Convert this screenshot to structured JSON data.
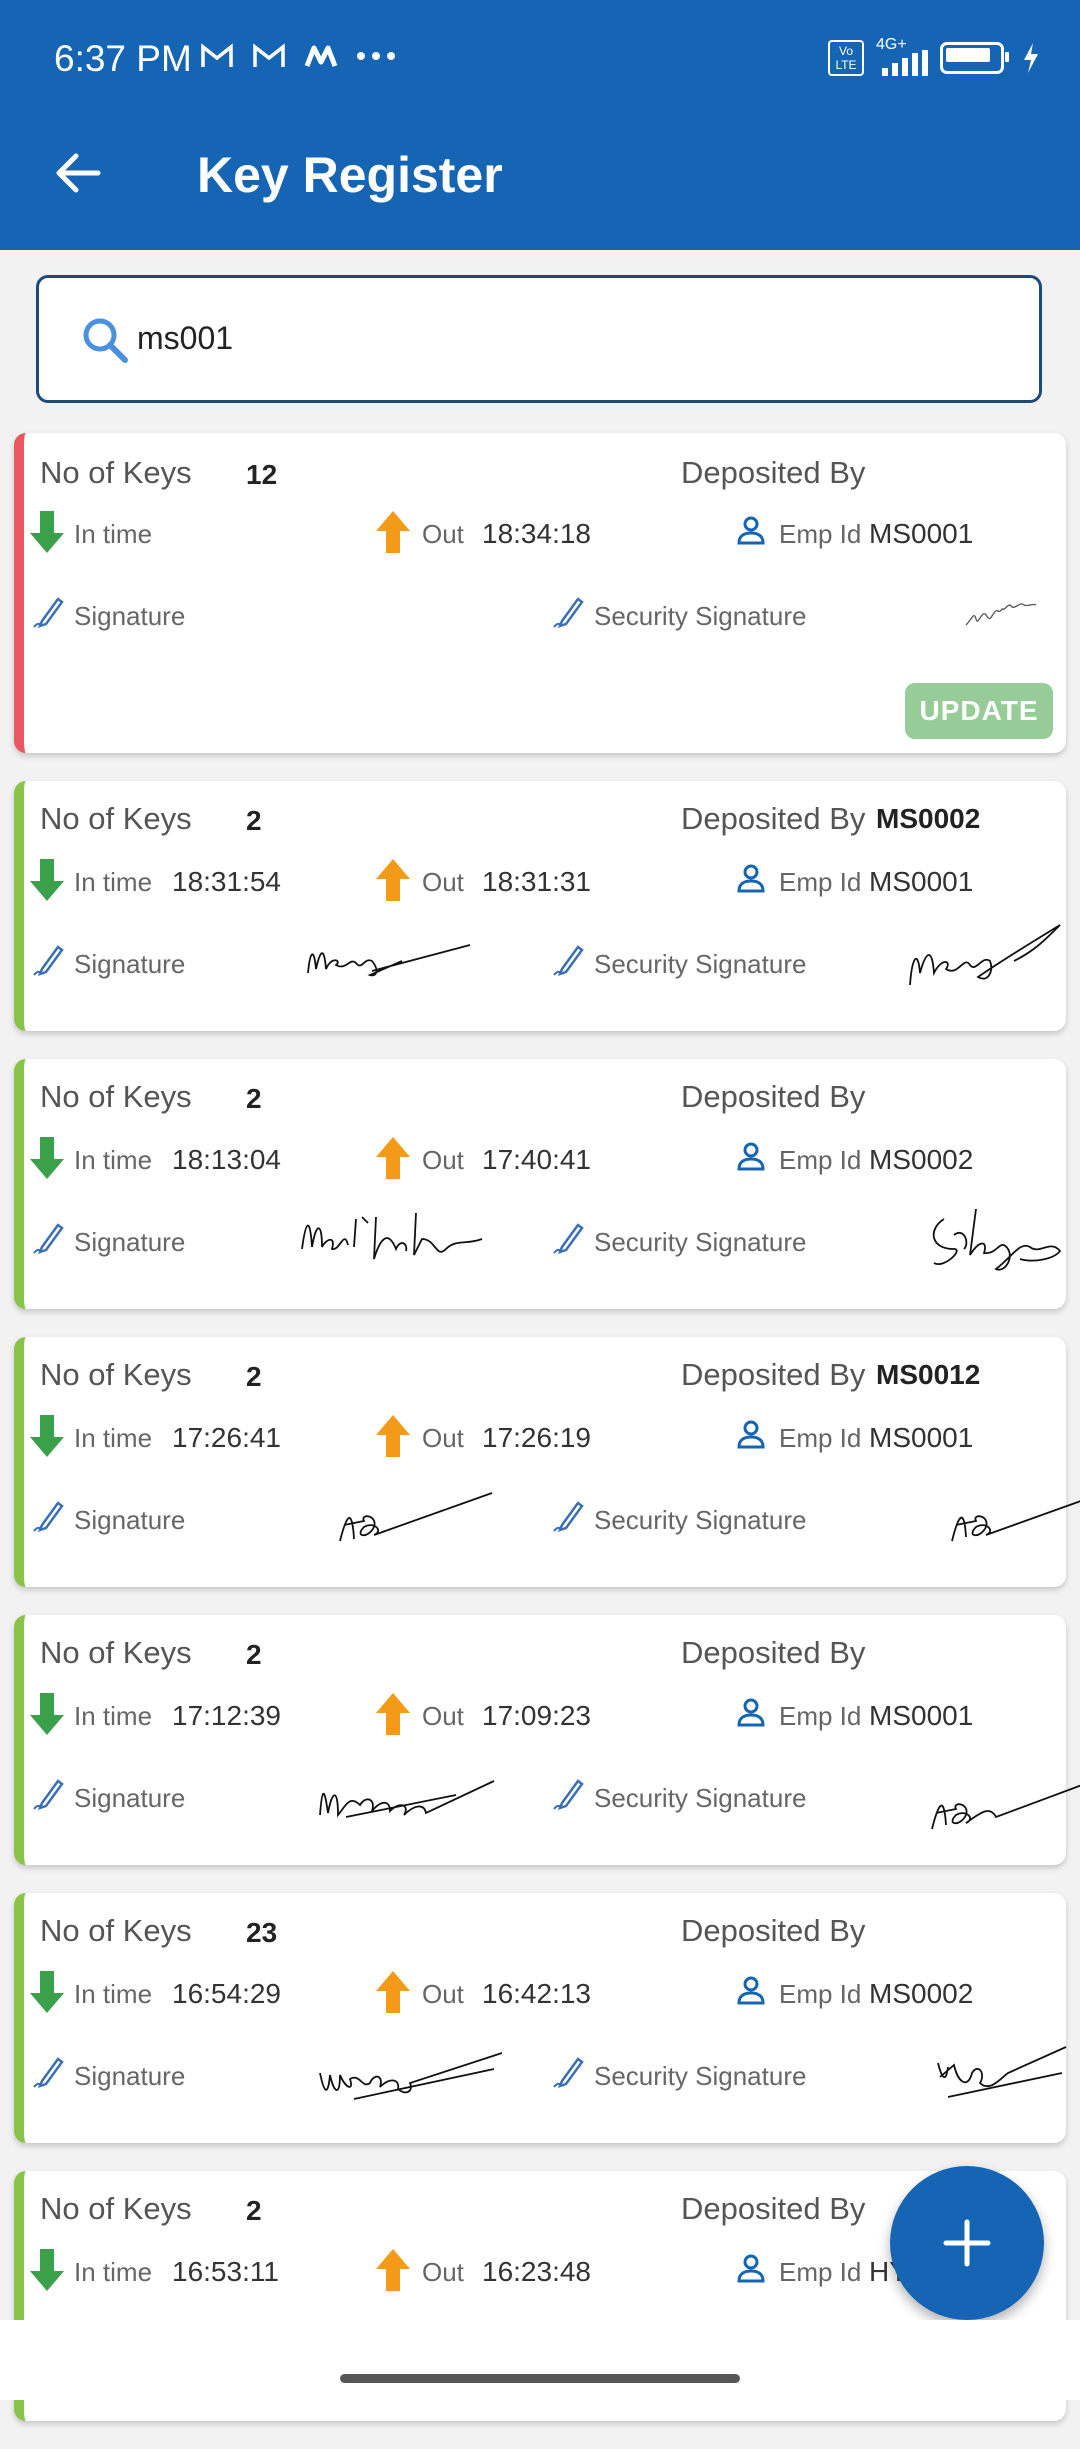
{
  "status_bar": {
    "time": "6:37 PM",
    "network_badge": "Vo LTE",
    "network_type": "4G+"
  },
  "header": {
    "title": "Key Register",
    "background": "#1565b4"
  },
  "search": {
    "value": "ms001"
  },
  "labels": {
    "no_of_keys": "No of Keys",
    "deposited_by": "Deposited By",
    "in_time": "In time",
    "out": "Out",
    "emp_id": "Emp Id",
    "signature": "Signature",
    "security_signature": "Security Signature",
    "update": "UPDATE"
  },
  "records": [
    {
      "no_of_keys": "12",
      "deposited_by": "",
      "in_time": "",
      "out_time": "18:34:18",
      "emp_id": "MS0001",
      "status_color": "#e8585e"
    },
    {
      "no_of_keys": "2",
      "deposited_by": "MS0002",
      "in_time": "18:31:54",
      "out_time": "18:31:31",
      "emp_id": "MS0001",
      "status_color": "#8bc34a"
    },
    {
      "no_of_keys": "2",
      "deposited_by": "",
      "in_time": "18:13:04",
      "out_time": "17:40:41",
      "emp_id": "MS0002",
      "status_color": "#8bc34a"
    },
    {
      "no_of_keys": "2",
      "deposited_by": "MS0012",
      "in_time": "17:26:41",
      "out_time": "17:26:19",
      "emp_id": "MS0001",
      "status_color": "#8bc34a"
    },
    {
      "no_of_keys": "2",
      "deposited_by": "",
      "in_time": "17:12:39",
      "out_time": "17:09:23",
      "emp_id": "MS0001",
      "status_color": "#8bc34a"
    },
    {
      "no_of_keys": "23",
      "deposited_by": "",
      "in_time": "16:54:29",
      "out_time": "16:42:13",
      "emp_id": "MS0002",
      "status_color": "#8bc34a"
    },
    {
      "no_of_keys": "2",
      "deposited_by": "",
      "in_time": "16:53:11",
      "out_time": "16:23:48",
      "emp_id": "HY",
      "status_color": "#8bc34a"
    }
  ]
}
